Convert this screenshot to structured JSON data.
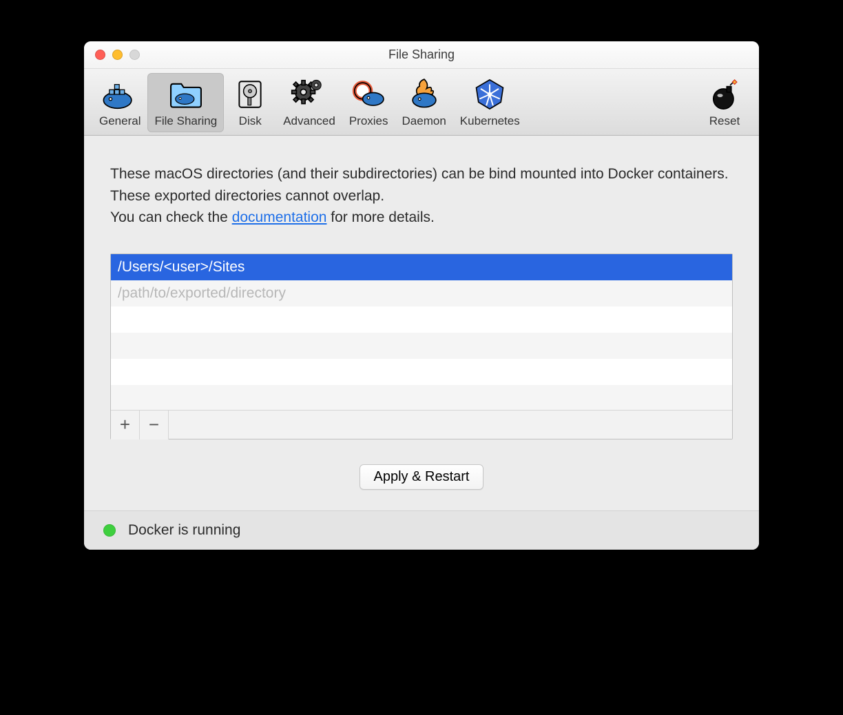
{
  "window": {
    "title": "File Sharing"
  },
  "tabs": {
    "general": "General",
    "filesharing": "File Sharing",
    "disk": "Disk",
    "advanced": "Advanced",
    "proxies": "Proxies",
    "daemon": "Daemon",
    "kubernetes": "Kubernetes",
    "reset": "Reset"
  },
  "description": {
    "line1": "These macOS directories (and their subdirectories) can be bind mounted into Docker containers. These exported directories cannot overlap.",
    "line2a": "You can check the ",
    "link": "documentation",
    "line2b": " for more details."
  },
  "paths": {
    "selected": "/Users/<user>/Sites",
    "placeholder": "/path/to/exported/directory"
  },
  "buttons": {
    "add": "+",
    "remove": "−",
    "apply": "Apply & Restart"
  },
  "status": {
    "text": "Docker is running",
    "color": "#3ecf3e"
  }
}
